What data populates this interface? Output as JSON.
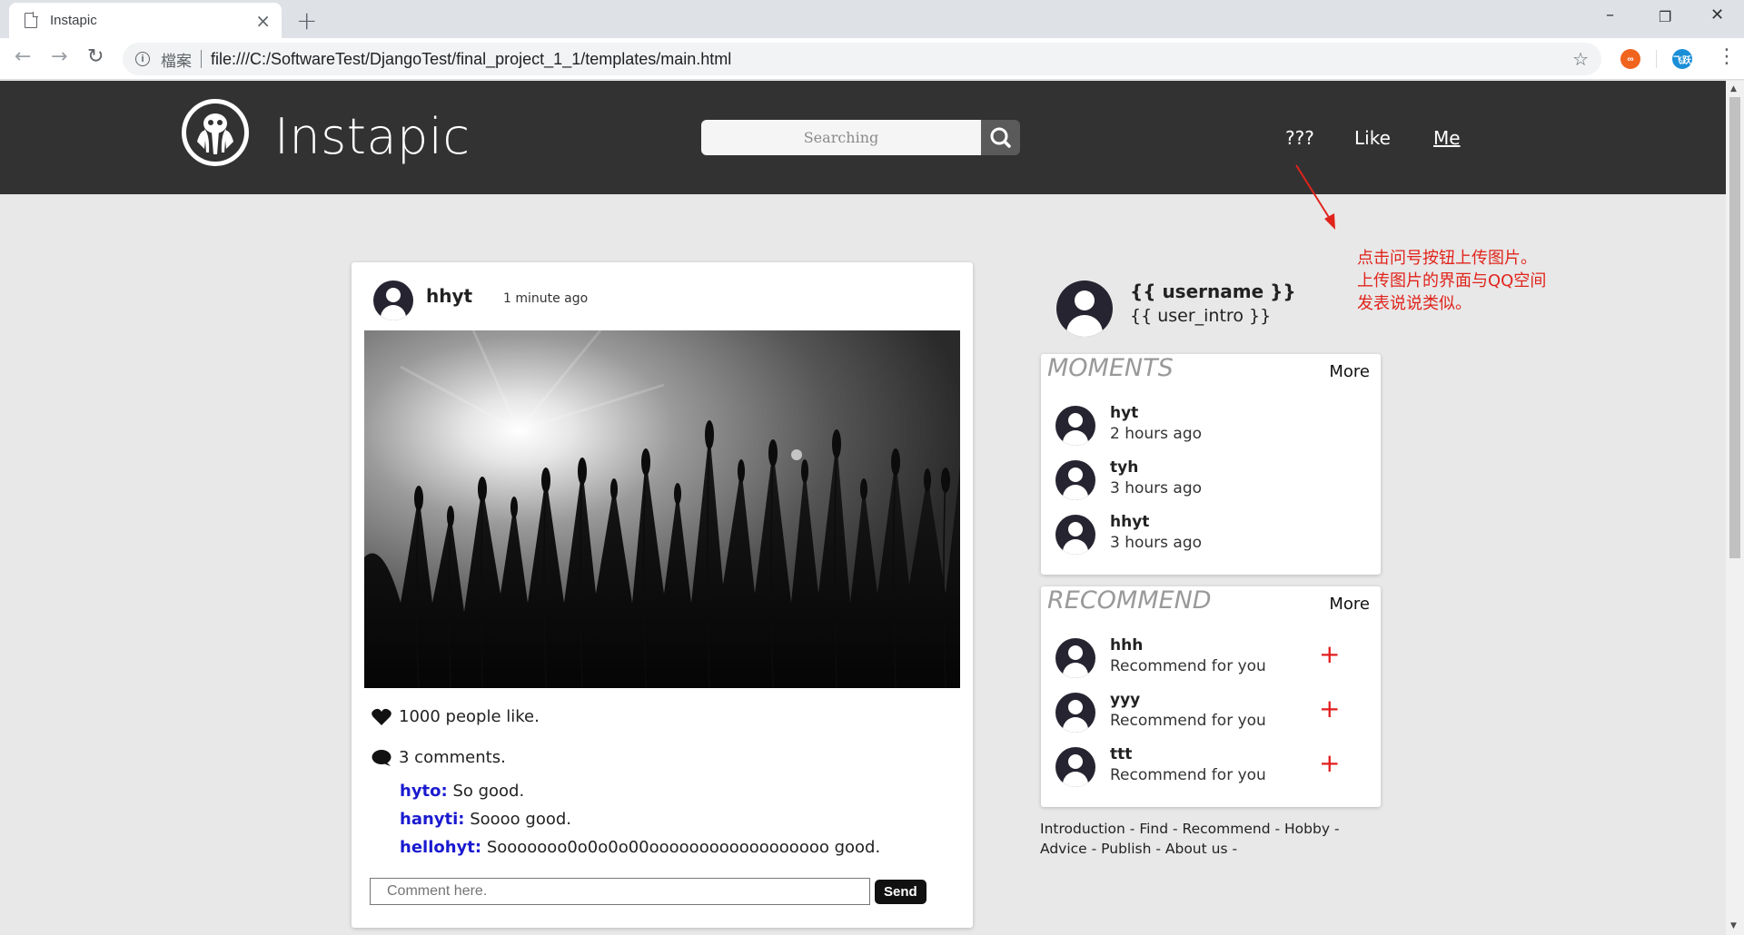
{
  "browser": {
    "tab_title": "Instapic",
    "security_label": "檔案",
    "url": "file:///C:/SoftwareTest/DjangoTest/final_project_1_1/templates/main.html",
    "ext1_label": "∞",
    "ext2_label": "飞跃"
  },
  "header": {
    "brand": "Instapic",
    "search_placeholder": "Searching",
    "nav": [
      "???",
      "Like",
      "Me"
    ]
  },
  "annotation": {
    "lines": [
      "点击问号按钮上传图片。",
      "上传图片的界面与QQ空间",
      "发表说说类似。"
    ],
    "color": "#e0241c"
  },
  "post": {
    "username": "hhyt",
    "time": "1 minute ago",
    "likes_text": "1000 people like.",
    "comments_text": "3 comments.",
    "comments": [
      {
        "user": "hyto:",
        "text": " So good."
      },
      {
        "user": "hanyti:",
        "text": " Soooo good."
      },
      {
        "user": "hellohyt:",
        "text": " Sooooooo0o0o0o00oooooooooooooooooo good."
      }
    ],
    "comment_placeholder": "Comment here.",
    "send_label": "Send"
  },
  "profile": {
    "username": "{{ username }}",
    "intro": "{{ user_intro }}"
  },
  "moments": {
    "title": "MOMENTS",
    "more": "More",
    "items": [
      {
        "name": "hyt",
        "time": "2 hours ago"
      },
      {
        "name": "tyh",
        "time": "3 hours ago"
      },
      {
        "name": "hhyt",
        "time": "3 hours ago"
      }
    ]
  },
  "recommend": {
    "title": "RECOMMEND",
    "more": "More",
    "items": [
      {
        "name": "hhh",
        "sub": "Recommend for you"
      },
      {
        "name": "yyy",
        "sub": "Recommend for you"
      },
      {
        "name": "ttt",
        "sub": "Recommend for you"
      }
    ],
    "plus_color": "#e31c1c"
  },
  "footer": {
    "links": [
      "Introduction",
      "Find",
      "Recommend",
      "Hobby",
      "Advice",
      "Publish",
      "About us"
    ]
  }
}
